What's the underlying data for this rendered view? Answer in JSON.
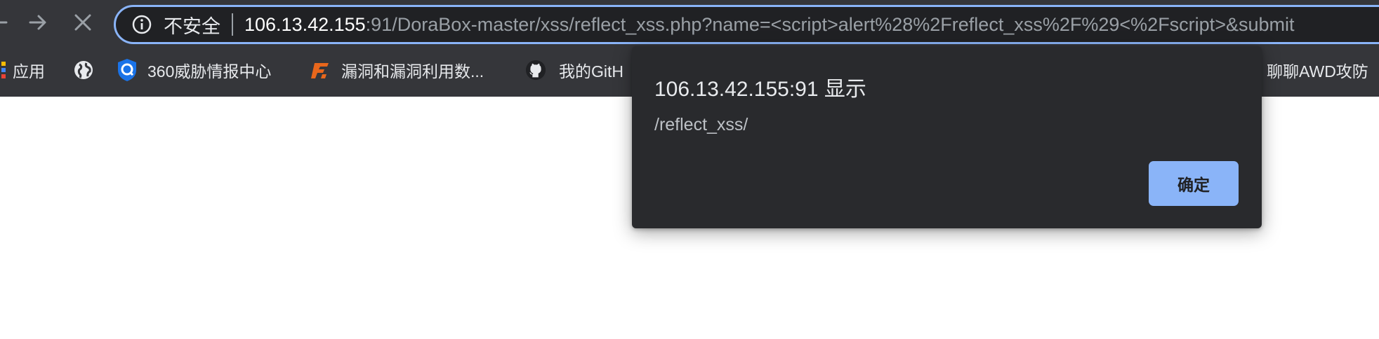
{
  "address_bar": {
    "security_label": "不安全",
    "url_host": "106.13.42.155",
    "url_rest": ":91/DoraBox-master/xss/reflect_xss.php?name=<script>alert%28%2Freflect_xss%2F%29<%2Fscript>&submit"
  },
  "bookmarks": [
    {
      "label": "应用",
      "icon": "apps-grid-icon"
    },
    {
      "label": "",
      "icon": "globe-icon"
    },
    {
      "label": "360威胁情报中心",
      "icon": "360-shield-icon"
    },
    {
      "label": "漏洞和漏洞利用数...",
      "icon": "exploit-db-icon"
    },
    {
      "label": "我的GitH",
      "icon": "github-icon"
    },
    {
      "label": "聊聊AWD攻防",
      "icon": ""
    }
  ],
  "dialog": {
    "title": "106.13.42.155:91 显示",
    "message": "/reflect_xss/",
    "ok_label": "确定"
  },
  "colors": {
    "chrome": "#35363a",
    "omnibox": "#202124",
    "accent": "#8ab4f8",
    "dialog": "#292a2d"
  }
}
